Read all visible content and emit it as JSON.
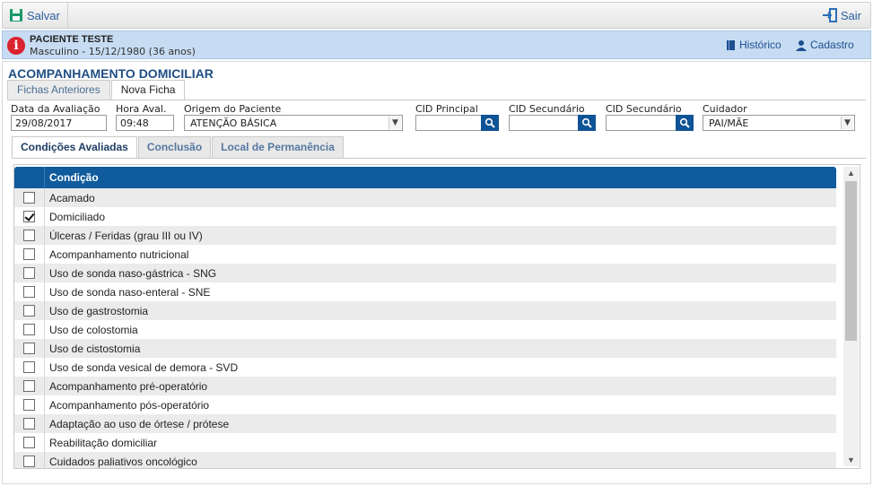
{
  "toolbar": {
    "save_label": "Salvar",
    "exit_label": "Sair"
  },
  "patient": {
    "name": "PACIENTE TESTE",
    "info": "Masculino - 15/12/1980 (36 anos)",
    "history_label": "Histórico",
    "register_label": "Cadastro"
  },
  "section_title": "ACOMPANHAMENTO DOMICILIAR",
  "top_tabs": [
    {
      "label": "Fichas Anteriores"
    },
    {
      "label": "Nova Ficha"
    }
  ],
  "form": {
    "date_label": "Data da Avaliação",
    "date_value": "29/08/2017",
    "time_label": "Hora Aval.",
    "time_value": "09:48",
    "origin_label": "Origem do Paciente",
    "origin_value": "ATENÇÃO BÁSICA",
    "cid_main_label": "CID Principal",
    "cid_sec1_label": "CID Secundário",
    "cid_sec2_label": "CID Secundário",
    "caregiver_label": "Cuidador",
    "caregiver_value": "PAI/MÃE"
  },
  "sub_tabs": [
    {
      "label": "Condições Avaliadas"
    },
    {
      "label": "Conclusão"
    },
    {
      "label": "Local de Permanência"
    }
  ],
  "grid": {
    "header": "Condição",
    "rows": [
      {
        "label": "Acamado",
        "checked": false
      },
      {
        "label": "Domiciliado",
        "checked": true
      },
      {
        "label": "Úlceras / Feridas (grau III ou IV)",
        "checked": false
      },
      {
        "label": "Acompanhamento nutricional",
        "checked": false
      },
      {
        "label": "Uso de sonda naso-gástrica - SNG",
        "checked": false
      },
      {
        "label": "Uso de sonda naso-enteral - SNE",
        "checked": false
      },
      {
        "label": "Uso de gastrostomia",
        "checked": false
      },
      {
        "label": "Uso de colostomia",
        "checked": false
      },
      {
        "label": "Uso de cistostomia",
        "checked": false
      },
      {
        "label": "Uso de sonda vesical de demora - SVD",
        "checked": false
      },
      {
        "label": "Acompanhamento pré-operatório",
        "checked": false
      },
      {
        "label": "Acompanhamento pós-operatório",
        "checked": false
      },
      {
        "label": "Adaptação ao uso de órtese / prótese",
        "checked": false
      },
      {
        "label": "Reabilitação domiciliar",
        "checked": false
      },
      {
        "label": "Cuidados paliativos oncológico",
        "checked": false
      }
    ]
  },
  "colors": {
    "accent": "#0f5b9c",
    "patient_bar": "#c7dcf2",
    "alert": "#d9232e"
  }
}
